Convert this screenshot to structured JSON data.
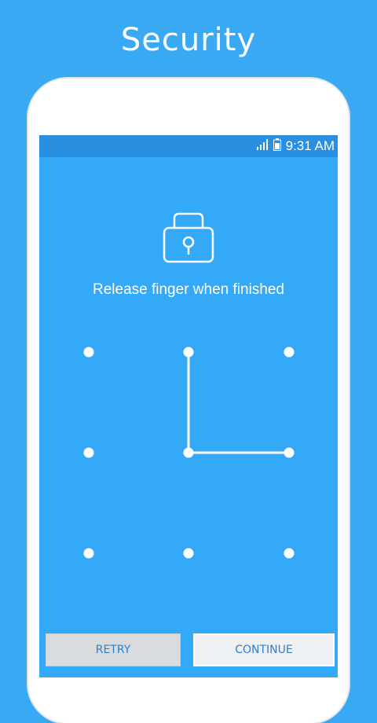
{
  "header": {
    "title": "Security"
  },
  "status_bar": {
    "time": "9:31 AM",
    "icons": [
      "signal-icon",
      "battery-icon"
    ]
  },
  "lock_screen": {
    "prompt": "Release finger when finished",
    "pattern_grid": [
      [
        1,
        2,
        3
      ],
      [
        4,
        5,
        6
      ],
      [
        7,
        8,
        9
      ]
    ],
    "drawn_sequence": [
      2,
      5,
      6
    ]
  },
  "buttons": {
    "retry": "RETRY",
    "continue": "CONTINUE"
  },
  "colors": {
    "background": "#3aa9f3",
    "status_bar": "#2a8fe0",
    "button_text": "#2d7fc8"
  }
}
